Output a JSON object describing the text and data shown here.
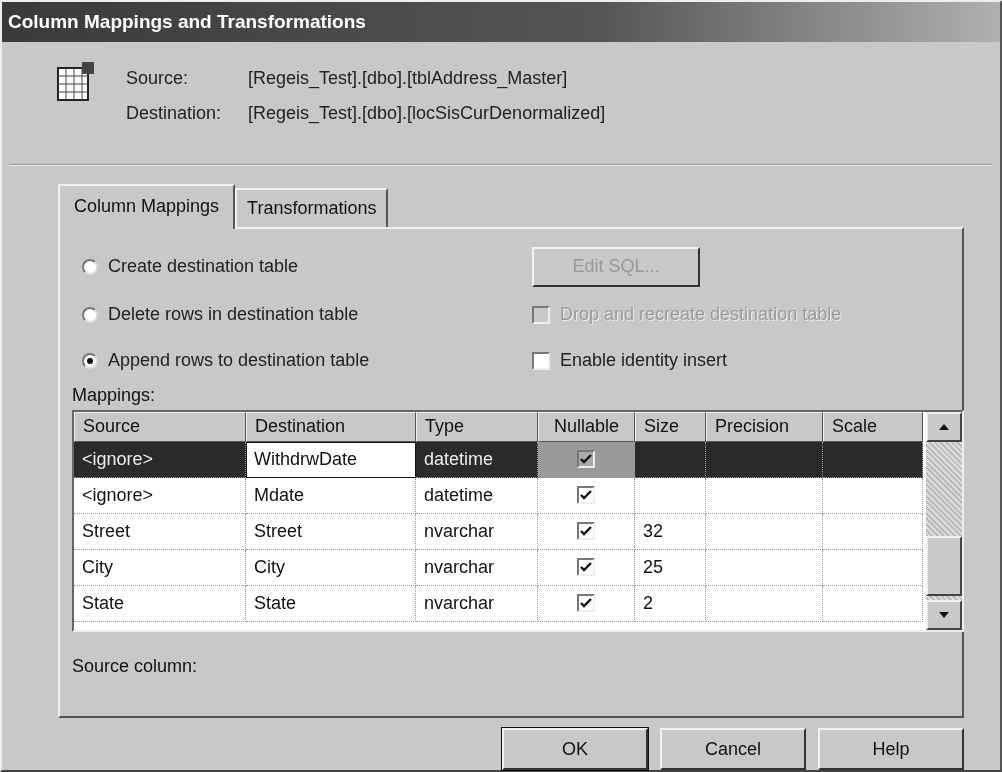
{
  "window": {
    "title": "Column Mappings and Transformations"
  },
  "header": {
    "source_label": "Source:",
    "source_value": "[Regeis_Test].[dbo].[tblAddress_Master]",
    "destination_label": "Destination:",
    "destination_value": "[Regeis_Test].[dbo].[locSisCurDenormalized]"
  },
  "tabs": [
    {
      "label": "Column Mappings",
      "selected": true
    },
    {
      "label": "Transformations",
      "selected": false
    }
  ],
  "options": [
    {
      "label": "Create destination table",
      "selected": false
    },
    {
      "label": "Delete rows in destination table",
      "selected": false
    },
    {
      "label": "Append rows to destination table",
      "selected": true
    }
  ],
  "edit_sql_button": {
    "label": "Edit SQL...",
    "disabled": true
  },
  "checkboxes": [
    {
      "label": "Drop and recreate destination table",
      "checked": false,
      "disabled": true
    },
    {
      "label": "Enable identity insert",
      "checked": false,
      "disabled": false
    }
  ],
  "mappings": {
    "label": "Mappings:",
    "columns": [
      "Source",
      "Destination",
      "Type",
      "Nullable",
      "Size",
      "Precision",
      "Scale"
    ],
    "rows": [
      {
        "source": "<ignore>",
        "destination": "WithdrwDate",
        "type": "datetime",
        "nullable": true,
        "size": "",
        "selected": true,
        "editing": true
      },
      {
        "source": "<ignore>",
        "destination": "Mdate",
        "type": "datetime",
        "nullable": true,
        "size": "",
        "selected": false,
        "editing": false
      },
      {
        "source": "Street",
        "destination": "Street",
        "type": "nvarchar",
        "nullable": true,
        "size": "32",
        "selected": false,
        "editing": false
      },
      {
        "source": "City",
        "destination": "City",
        "type": "nvarchar",
        "nullable": true,
        "size": "25",
        "selected": false,
        "editing": false
      },
      {
        "source": "State",
        "destination": "State",
        "type": "nvarchar",
        "nullable": true,
        "size": "2",
        "selected": false,
        "editing": false
      }
    ]
  },
  "source_column_label": "Source column:",
  "buttons": [
    "OK",
    "Cancel",
    "Help"
  ]
}
